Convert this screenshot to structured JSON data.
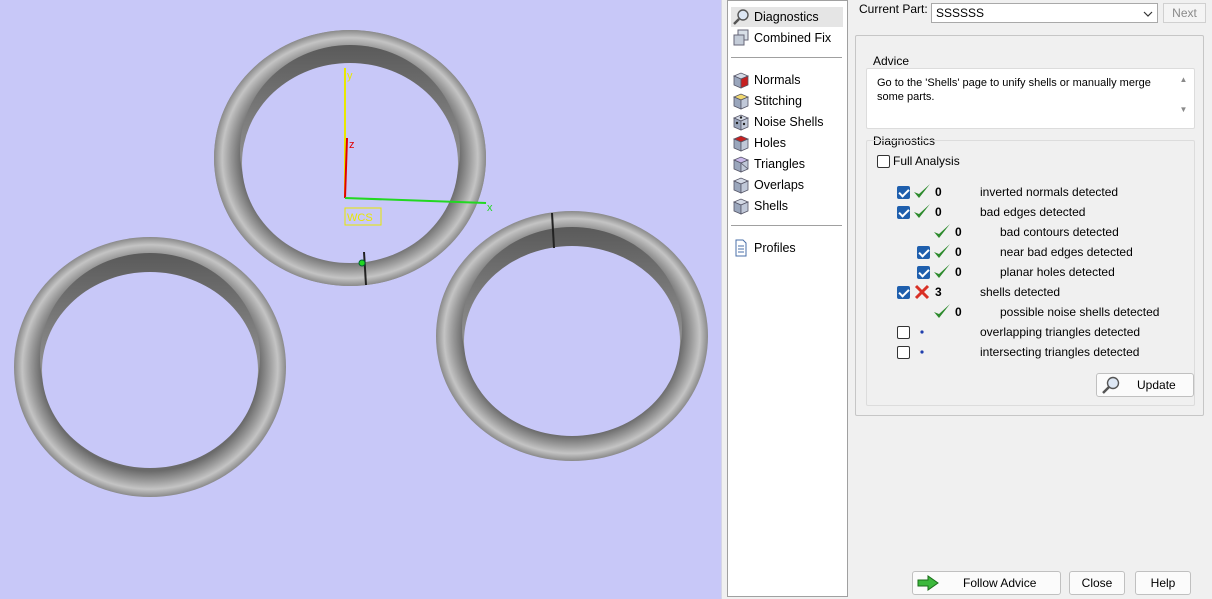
{
  "viewport": {
    "background": "#c8c8f8",
    "axes": {
      "y_label": "y",
      "z_label": "z",
      "x_label": "x",
      "wcs_label": "WCS"
    }
  },
  "nav": {
    "items": [
      {
        "label": "Diagnostics",
        "icon": "magnifier-icon",
        "active": true
      },
      {
        "label": "Combined Fix",
        "icon": "combined-fix-icon"
      },
      {
        "label": "Normals",
        "icon": "normals-cube-icon"
      },
      {
        "label": "Stitching",
        "icon": "stitching-cube-icon"
      },
      {
        "label": "Noise Shells",
        "icon": "noise-shells-icon"
      },
      {
        "label": "Holes",
        "icon": "holes-cube-icon"
      },
      {
        "label": "Triangles",
        "icon": "triangles-cube-icon"
      },
      {
        "label": "Overlaps",
        "icon": "overlaps-cube-icon"
      },
      {
        "label": "Shells",
        "icon": "shells-cube-icon"
      },
      {
        "label": "Profiles",
        "icon": "document-icon"
      }
    ]
  },
  "header": {
    "current_part_label": "Current Part:",
    "current_part_value": "SSSSSS",
    "next_label": "Next"
  },
  "advice": {
    "title": "Advice",
    "text": "Go to the 'Shells' page to unify shells or manually merge some parts."
  },
  "diagnostics": {
    "title": "Diagnostics",
    "full_analysis_label": "Full Analysis",
    "full_analysis_checked": false,
    "rows": [
      {
        "checkbox": true,
        "checked": true,
        "status": "ok",
        "count": "0",
        "label": "inverted normals detected",
        "indent": 0
      },
      {
        "checkbox": true,
        "checked": true,
        "status": "ok",
        "count": "0",
        "label": "bad edges detected",
        "indent": 0
      },
      {
        "checkbox": false,
        "checked": false,
        "status": "ok",
        "count": "0",
        "label": "bad contours detected",
        "indent": 1
      },
      {
        "checkbox": true,
        "checked": true,
        "status": "ok",
        "count": "0",
        "label": "near bad edges detected",
        "indent": 1
      },
      {
        "checkbox": true,
        "checked": true,
        "status": "ok",
        "count": "0",
        "label": "planar holes detected",
        "indent": 1
      },
      {
        "checkbox": true,
        "checked": true,
        "status": "error",
        "count": "3",
        "label": "shells detected",
        "indent": 0
      },
      {
        "checkbox": false,
        "checked": false,
        "status": "ok",
        "count": "0",
        "label": "possible noise shells detected",
        "indent": 1
      },
      {
        "checkbox": true,
        "checked": false,
        "status": "none",
        "count": "",
        "label": "overlapping triangles detected",
        "indent": 0
      },
      {
        "checkbox": true,
        "checked": false,
        "status": "none",
        "count": "",
        "label": "intersecting triangles detected",
        "indent": 0
      }
    ],
    "update_label": "Update"
  },
  "footer": {
    "follow_advice_label": "Follow Advice",
    "close_label": "Close",
    "help_label": "Help"
  },
  "colors": {
    "ok": "#2e8b2e",
    "error": "#d93025",
    "checkbox": "#1f5fad",
    "axis_y": "#e8e800",
    "axis_z": "#e00000",
    "axis_x": "#22d822"
  }
}
